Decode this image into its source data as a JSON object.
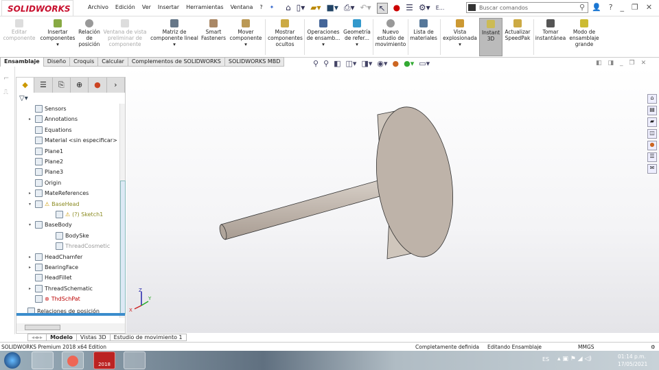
{
  "app": {
    "logo": "SOLIDWORKS",
    "menus": [
      "Archivo",
      "Edición",
      "Ver",
      "Insertar",
      "Herramientas",
      "Ventana",
      "?"
    ],
    "search_placeholder": "Buscar comandos",
    "e_label": "E..."
  },
  "ribbon": [
    {
      "label": "Editar componente",
      "disabled": true
    },
    {
      "label": "Insertar componentes"
    },
    {
      "label": "Relación de posición"
    },
    {
      "label": "Ventana de vista preliminar de componente",
      "disabled": true
    },
    {
      "label": "Matriz de componente lineal"
    },
    {
      "label": "Smart Fasteners"
    },
    {
      "label": "Mover componente"
    },
    {
      "label": "Mostrar componentes ocultos"
    },
    {
      "label": "Operaciones de ensamb..."
    },
    {
      "label": "Geometría de refer..."
    },
    {
      "label": "Nuevo estudio de movimiento"
    },
    {
      "label": "Lista de materiales"
    },
    {
      "label": "Vista explosionada"
    },
    {
      "label": "Instant 3D",
      "active": true
    },
    {
      "label": "Actualizar SpeedPak"
    },
    {
      "label": "Tomar instantánea"
    },
    {
      "label": "Modo de ensamblaje grande"
    }
  ],
  "tabs": [
    "Ensamblaje",
    "Diseño",
    "Croquis",
    "Calcular",
    "Complementos de SOLIDWORKS",
    "SOLIDWORKS MBD"
  ],
  "tree": [
    {
      "label": "Sensors"
    },
    {
      "label": "Annotations",
      "expand": true
    },
    {
      "label": "Equations"
    },
    {
      "label": "Material <sin especificar>"
    },
    {
      "label": "Plane1"
    },
    {
      "label": "Plane2"
    },
    {
      "label": "Plane3"
    },
    {
      "label": "Origin"
    },
    {
      "label": "MateReferences",
      "expand": true
    },
    {
      "label": "BaseHead",
      "state": "warning",
      "expanded": true
    },
    {
      "label": "(?) Sketch1",
      "state": "warning",
      "child": true
    },
    {
      "label": "BaseBody",
      "expanded": true
    },
    {
      "label": "BodySke",
      "child": true
    },
    {
      "label": "ThreadCosmetic",
      "child": true,
      "state": "suppressed"
    },
    {
      "label": "HeadChamfer",
      "expand": true
    },
    {
      "label": "BearingFace",
      "expand": true
    },
    {
      "label": "HeadFillet"
    },
    {
      "label": "ThreadSchematic",
      "expand": true
    },
    {
      "label": "ThdSchPat",
      "state": "error"
    }
  ],
  "mates": "Relaciones de posición",
  "bottom_tabs": [
    "Modelo",
    "Vistas 3D",
    "Estudio de movimiento 1"
  ],
  "status": {
    "edition": "SOLIDWORKS Premium 2018 x64 Edition",
    "defined": "Completamente definida",
    "editing": "Editando Ensamblaje",
    "units": "MMGS"
  },
  "taskbar": {
    "lang": "ES",
    "time": "01:14 p.m.",
    "date": "17/05/2021",
    "sw_badge": "2018"
  },
  "triad": {
    "x": "X",
    "y": "Y",
    "z": "Z"
  }
}
